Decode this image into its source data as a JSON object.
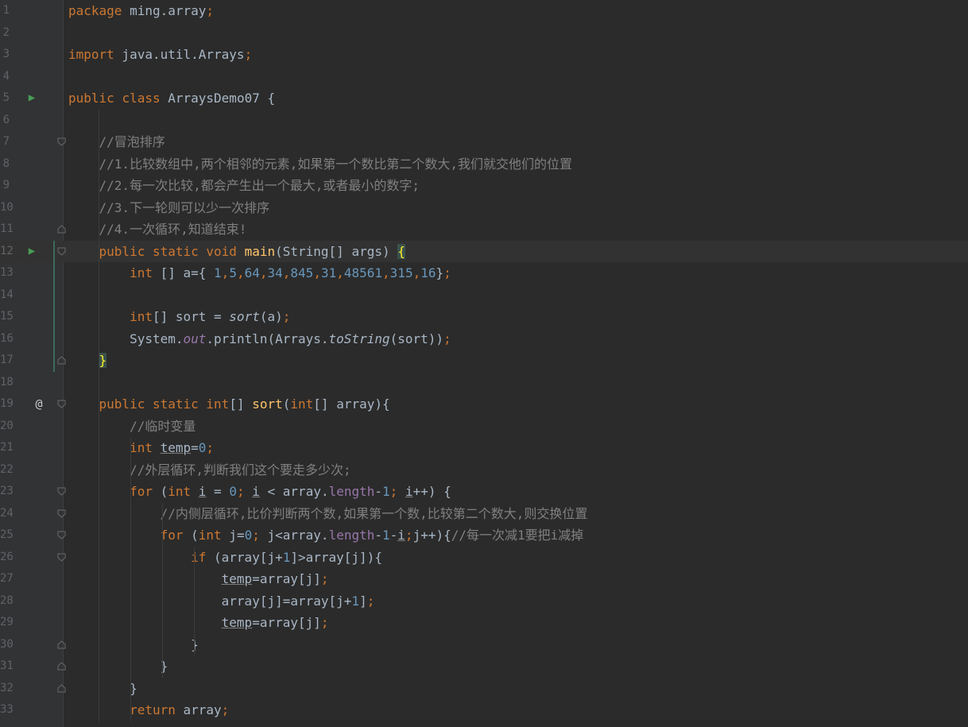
{
  "editor": {
    "current_line": 12,
    "lines": [
      {
        "n": "1",
        "text": "package ming.array;"
      },
      {
        "n": "2",
        "text": ""
      },
      {
        "n": "3",
        "text": "import java.util.Arrays;"
      },
      {
        "n": "4",
        "text": ""
      },
      {
        "n": "5",
        "text": "public class ArraysDemo07 {"
      },
      {
        "n": "6",
        "text": ""
      },
      {
        "n": "7",
        "text": "    //冒泡排序"
      },
      {
        "n": "8",
        "text": "    //1.比较数组中,两个相邻的元素,如果第一个数比第二个数大,我们就交他们的位置"
      },
      {
        "n": "9",
        "text": "    //2.每一次比较,都会产生出一个最大,或者最小的数字;"
      },
      {
        "n": "10",
        "text": "    //3.下一轮则可以少一次排序"
      },
      {
        "n": "11",
        "text": "    //4.一次循环,知道结束!"
      },
      {
        "n": "12",
        "text": "    public static void main(String[] args) {"
      },
      {
        "n": "13",
        "text": "        int [] a={ 1,5,64,34,845,31,48561,315,16};"
      },
      {
        "n": "14",
        "text": ""
      },
      {
        "n": "15",
        "text": "        int[] sort = sort(a);"
      },
      {
        "n": "16",
        "text": "        System.out.println(Arrays.toString(sort));"
      },
      {
        "n": "17",
        "text": "    }"
      },
      {
        "n": "18",
        "text": ""
      },
      {
        "n": "19",
        "text": "    public static int[] sort(int[] array){"
      },
      {
        "n": "20",
        "text": "        //临时变量"
      },
      {
        "n": "21",
        "text": "        int temp=0;"
      },
      {
        "n": "22",
        "text": "        //外层循环,判断我们这个要走多少次;"
      },
      {
        "n": "23",
        "text": "        for (int i = 0; i < array.length-1; i++) {"
      },
      {
        "n": "24",
        "text": "            //内侧层循环,比价判断两个数,如果第一个数,比较第二个数大,则交换位置"
      },
      {
        "n": "25",
        "text": "            for (int j=0; j<array.length-1-i;j++){//每一次减1要把i减掉"
      },
      {
        "n": "26",
        "text": "                if (array[j+1]>array[j]){"
      },
      {
        "n": "27",
        "text": "                    temp=array[j];"
      },
      {
        "n": "28",
        "text": "                    array[j]=array[j+1];"
      },
      {
        "n": "29",
        "text": "                    temp=array[j];"
      },
      {
        "n": "30",
        "text": "                }"
      },
      {
        "n": "31",
        "text": "            }"
      },
      {
        "n": "32",
        "text": "        }"
      },
      {
        "n": "33",
        "text": "        return array;"
      }
    ]
  },
  "icons": {
    "run": "run-gutter-icon",
    "override": "override-gutter-icon",
    "fold": "fold-icon",
    "colors": {
      "run": "#499c54",
      "keyword": "#cc7832",
      "number": "#6897bb",
      "comment": "#808080",
      "method": "#ffc66d",
      "field": "#9876aa"
    }
  }
}
